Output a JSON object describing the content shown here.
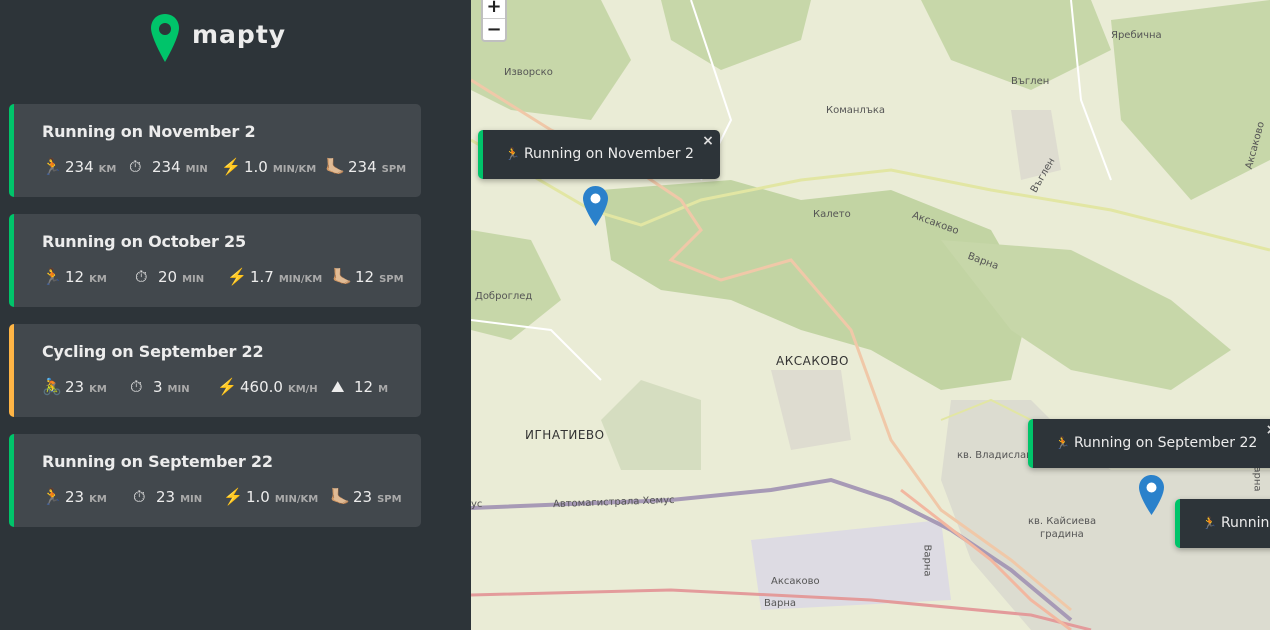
{
  "app": {
    "name": "mapty"
  },
  "workouts": [
    {
      "title": "Running on November 2",
      "type": "running",
      "details": [
        {
          "icon": "🏃",
          "value": "234",
          "unit": "km"
        },
        {
          "icon": "⏱",
          "value": "234",
          "unit": "min"
        },
        {
          "icon": "⚡️",
          "value": "1.0",
          "unit": "min/km"
        },
        {
          "icon": "🦶🏼",
          "value": "234",
          "unit": "spm"
        }
      ]
    },
    {
      "title": "Running on October 25",
      "type": "running",
      "details": [
        {
          "icon": "🏃",
          "value": "12",
          "unit": "km"
        },
        {
          "icon": "⏱",
          "value": "20",
          "unit": "min"
        },
        {
          "icon": "⚡️",
          "value": "1.7",
          "unit": "min/km"
        },
        {
          "icon": "🦶🏼",
          "value": "12",
          "unit": "spm"
        }
      ]
    },
    {
      "title": "Cycling on September 22",
      "type": "cycling",
      "details": [
        {
          "icon": "🚴",
          "value": "23",
          "unit": "km"
        },
        {
          "icon": "⏱",
          "value": "3",
          "unit": "min"
        },
        {
          "icon": "⚡️",
          "value": "460.0",
          "unit": "km/h"
        },
        {
          "icon": "⛰",
          "value": "12",
          "unit": "m"
        }
      ]
    },
    {
      "title": "Running on September 22",
      "type": "running",
      "details": [
        {
          "icon": "🏃",
          "value": "23",
          "unit": "km"
        },
        {
          "icon": "⏱",
          "value": "23",
          "unit": "min"
        },
        {
          "icon": "⚡️",
          "value": "1.0",
          "unit": "min/km"
        },
        {
          "icon": "🦶🏼",
          "value": "23",
          "unit": "spm"
        }
      ]
    }
  ],
  "map": {
    "zoom_in": "+",
    "zoom_out": "−",
    "labels": {
      "izvorsko": "Изворско",
      "komanlka": "Команлъка",
      "yarebichna": "Яребична",
      "valchen": "Въглен",
      "valchen2": "Въглен",
      "kaleto": "Калето",
      "aksakovo_road": "Аксаково",
      "varna_road": "Варна",
      "dobrogled": "Доброглед",
      "aksakovo": "АКСАКОВО",
      "ignatievo": "ИГНАТИЕВО",
      "hemus": "Автомагистрала Хемус",
      "hemus_left": "ус",
      "vladislav": "кв. Владислав",
      "kaysieva1": "кв. Кайсиева",
      "kaysieva2": "градина",
      "aksakovo_bottom": "Аксаково",
      "varna_bottom": "Варна",
      "varna_vertical": "Варна",
      "varna_right": "Варна",
      "aksakovo_right": "Аксаково"
    },
    "popups": [
      {
        "icon": "🏃",
        "text": "Running on November 2",
        "close": "×"
      },
      {
        "icon": "🏃",
        "text": "Running on September 22",
        "close": "×"
      },
      {
        "icon": "🏃",
        "text": "Running",
        "close": ""
      }
    ]
  },
  "colors": {
    "running": "#00c46a",
    "cycling": "#ffb545",
    "panel": "#2d3439",
    "card": "#42484d"
  }
}
